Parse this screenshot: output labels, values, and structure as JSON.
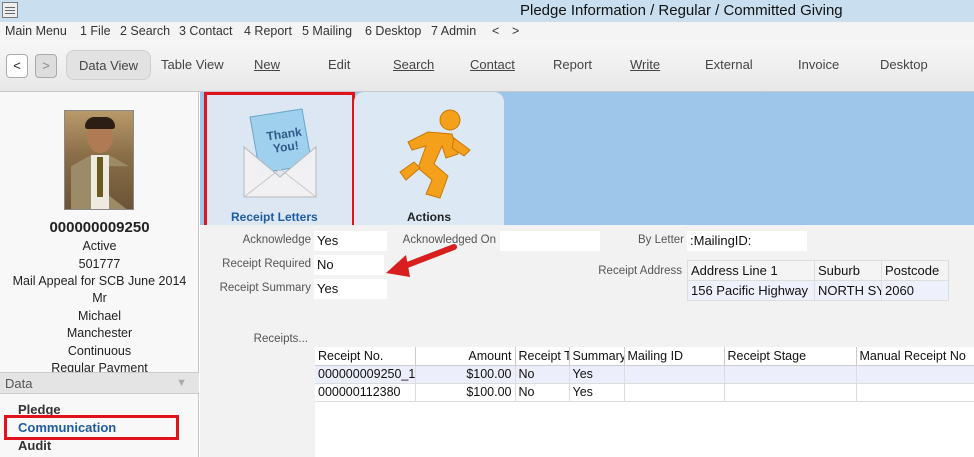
{
  "window": {
    "title": "Pledge Information / Regular / Committed Giving"
  },
  "menu": [
    "Main Menu",
    "1 File",
    "2 Search",
    "3 Contact",
    "4 Report",
    "5 Mailing",
    "6 Desktop",
    "7 Admin",
    "<",
    ">"
  ],
  "toolbar": {
    "back": "<",
    "forward": ">",
    "data_view": "Data View",
    "table_view": "Table View",
    "new": "New",
    "edit": "Edit",
    "search": "Search",
    "contact": "Contact",
    "report": "Report",
    "write": "Write",
    "external": "External",
    "invoice": "Invoice",
    "desktop": "Desktop"
  },
  "contact": {
    "id": "000000009250",
    "status": "Active",
    "number": "501777",
    "appeal": "Mail Appeal for SCB June 2014",
    "title": "Mr",
    "first_name": "Michael",
    "city": "Manchester",
    "frequency": "Continuous",
    "payment_type": "Regular Payment"
  },
  "data_nav": {
    "header": "Data",
    "items": [
      "Pledge",
      "Communication",
      "Audit"
    ]
  },
  "tabs": [
    {
      "label": "Receipt Letters",
      "icon": "thank-you-envelope-icon",
      "card_text": "Thank You!"
    },
    {
      "label": "Actions",
      "icon": "running-man-icon"
    }
  ],
  "form": {
    "acknowledge_label": "Acknowledge",
    "acknowledge_value": "Yes",
    "acknowledged_on_label": "Acknowledged On",
    "acknowledged_on_value": "",
    "by_letter_label": "By Letter",
    "by_letter_value": ":MailingID:",
    "receipt_required_label": "Receipt Required",
    "receipt_required_value": "No",
    "receipt_summary_label": "Receipt Summary",
    "receipt_summary_value": "Yes",
    "receipt_address_label": "Receipt Address",
    "receipts_label": "Receipts..."
  },
  "address": {
    "headers": [
      "Address Line 1",
      "Suburb",
      "Postcode"
    ],
    "row": [
      "156 Pacific Highway",
      "NORTH SYDNEY",
      "2060"
    ]
  },
  "receipts": {
    "headers": [
      "Receipt No.",
      "Amount",
      "Receipt Type",
      "Summary",
      "Mailing ID",
      "Receipt Stage",
      "Manual Receipt No"
    ],
    "rows": [
      [
        "000000009250_1",
        "$100.00",
        "No",
        "Yes",
        "",
        "",
        ""
      ],
      [
        "000000112380",
        "$100.00",
        "No",
        "Yes",
        "",
        "",
        ""
      ]
    ]
  },
  "colors": {
    "highlight": "#e0121b",
    "tab_strip": "#9ec6ea",
    "selected_nav": "#1f5c9e",
    "arrow": "#d81e1e",
    "runner": "#f5a01a"
  }
}
